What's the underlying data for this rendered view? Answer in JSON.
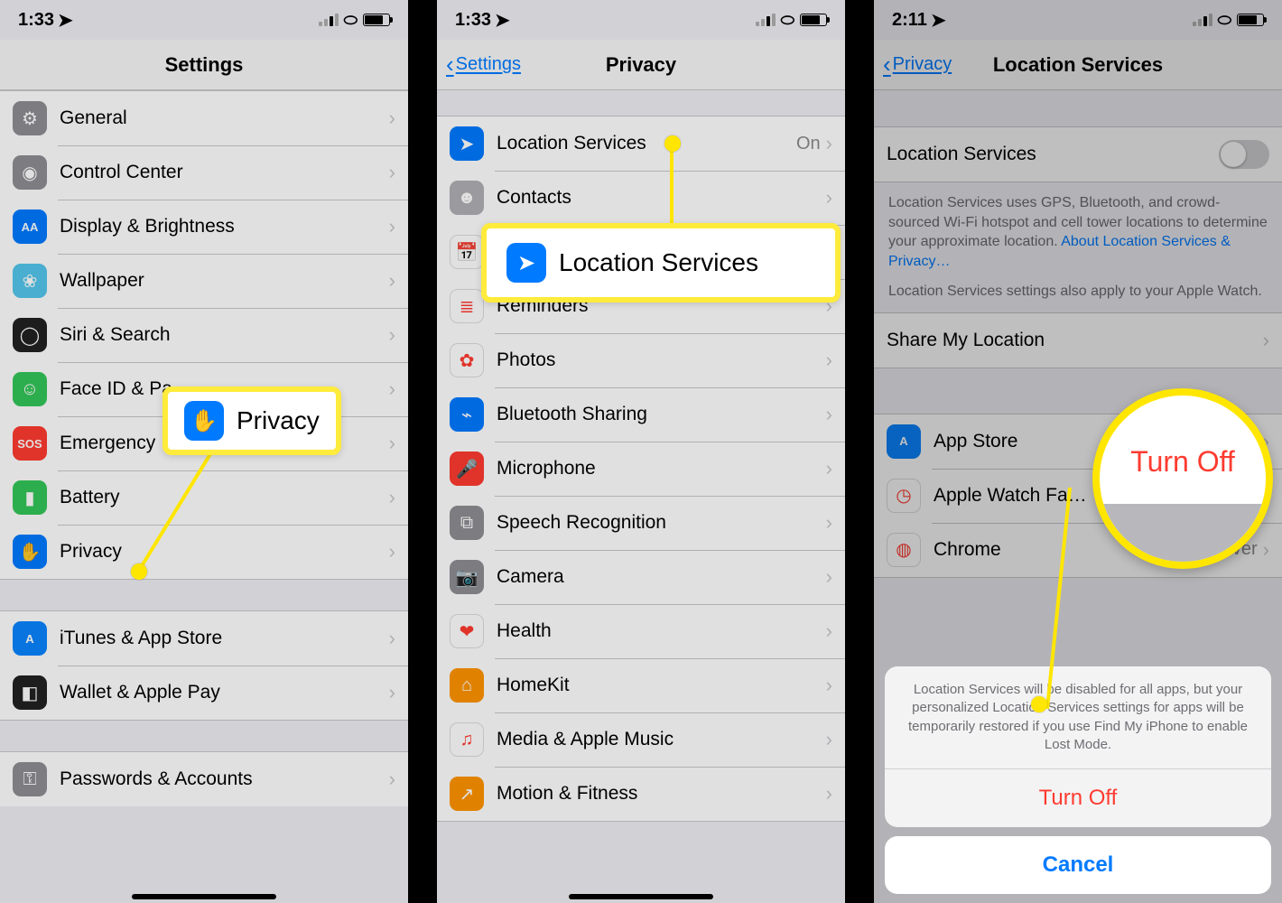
{
  "panel1": {
    "time": "1:33",
    "title": "Settings",
    "items": [
      {
        "id": "general",
        "label": "General",
        "bg": "#8e8e93",
        "glyph": "⚙"
      },
      {
        "id": "control-center",
        "label": "Control Center",
        "bg": "#8e8e93",
        "glyph": "◉"
      },
      {
        "id": "display",
        "label": "Display & Brightness",
        "bg": "#007aff",
        "glyph": "AA"
      },
      {
        "id": "wallpaper",
        "label": "Wallpaper",
        "bg": "#54c7ec",
        "glyph": "❀"
      },
      {
        "id": "siri",
        "label": "Siri & Search",
        "bg": "#222",
        "glyph": "◯"
      },
      {
        "id": "faceid",
        "label": "Face ID & Pa",
        "bg": "#34c759",
        "glyph": "☺"
      },
      {
        "id": "sos",
        "label": "Emergency",
        "bg": "#ff3b30",
        "glyph": "SOS"
      },
      {
        "id": "battery",
        "label": "Battery",
        "bg": "#34c759",
        "glyph": "▮"
      },
      {
        "id": "privacy",
        "label": "Privacy",
        "bg": "#007aff",
        "glyph": "✋"
      }
    ],
    "items2": [
      {
        "id": "itunes",
        "label": "iTunes & App Store",
        "bg": "#0a84ff",
        "glyph": "A"
      },
      {
        "id": "wallet",
        "label": "Wallet & Apple Pay",
        "bg": "#222",
        "glyph": "◧"
      }
    ],
    "items3": [
      {
        "id": "passwords",
        "label": "Passwords & Accounts",
        "bg": "#8e8e93",
        "glyph": "⚿"
      }
    ],
    "callout_label": "Privacy",
    "callout_glyph": "✋"
  },
  "panel2": {
    "time": "1:33",
    "back": "Settings",
    "title": "Privacy",
    "items": [
      {
        "id": "location",
        "label": "Location Services",
        "value": "On",
        "bg": "#007aff",
        "glyph": "➤"
      },
      {
        "id": "contacts",
        "label": "Contacts",
        "bg": "#b0b0b5",
        "glyph": "☻"
      },
      {
        "id": "calendars",
        "label": "Calendars",
        "bg": "#fff",
        "glyph": "📅"
      },
      {
        "id": "reminders",
        "label": "Reminders",
        "bg": "#fff",
        "glyph": "≣"
      },
      {
        "id": "photos",
        "label": "Photos",
        "bg": "#fff",
        "glyph": "✿"
      },
      {
        "id": "bluetooth",
        "label": "Bluetooth Sharing",
        "bg": "#007aff",
        "glyph": "⌁"
      },
      {
        "id": "microphone",
        "label": "Microphone",
        "bg": "#ff3b30",
        "glyph": "🎤"
      },
      {
        "id": "speech",
        "label": "Speech Recognition",
        "bg": "#8e8e93",
        "glyph": "⧉"
      },
      {
        "id": "camera",
        "label": "Camera",
        "bg": "#8e8e93",
        "glyph": "📷"
      },
      {
        "id": "health",
        "label": "Health",
        "bg": "#fff",
        "glyph": "❤"
      },
      {
        "id": "homekit",
        "label": "HomeKit",
        "bg": "#ff9500",
        "glyph": "⌂"
      },
      {
        "id": "media",
        "label": "Media & Apple Music",
        "bg": "#fff",
        "glyph": "♫"
      },
      {
        "id": "motion",
        "label": "Motion & Fitness",
        "bg": "#ff9500",
        "glyph": "↗"
      }
    ],
    "callout_label": "Location Services",
    "callout_glyph": "➤"
  },
  "panel3": {
    "time": "2:11",
    "back": "Privacy",
    "title": "Location Services",
    "toggle_label": "Location Services",
    "desc1": "Location Services uses GPS, Bluetooth, and crowd-sourced Wi-Fi hotspot and cell tower locations to determine your approximate location.",
    "desc1_link": "About Location Services & Privacy…",
    "desc2": "Location Services settings also apply to your Apple Watch.",
    "share_label": "Share My Location",
    "apps": [
      {
        "id": "appstore",
        "label": "App Store",
        "bg": "#0a84ff",
        "glyph": "A"
      },
      {
        "id": "watch",
        "label": "Apple Watch Fa…",
        "bg": "#fff",
        "glyph": "◷"
      },
      {
        "id": "chrome",
        "label": "Chrome",
        "value": "Never",
        "bg": "#fff",
        "glyph": "◍"
      }
    ],
    "sheet_msg": "Location Services will be disabled for all apps, but your personalized Location Services settings for apps will be temporarily restored if you use Find My iPhone to enable Lost Mode.",
    "turnoff": "Turn Off",
    "cancel": "Cancel",
    "callout_label": "Turn Off"
  }
}
